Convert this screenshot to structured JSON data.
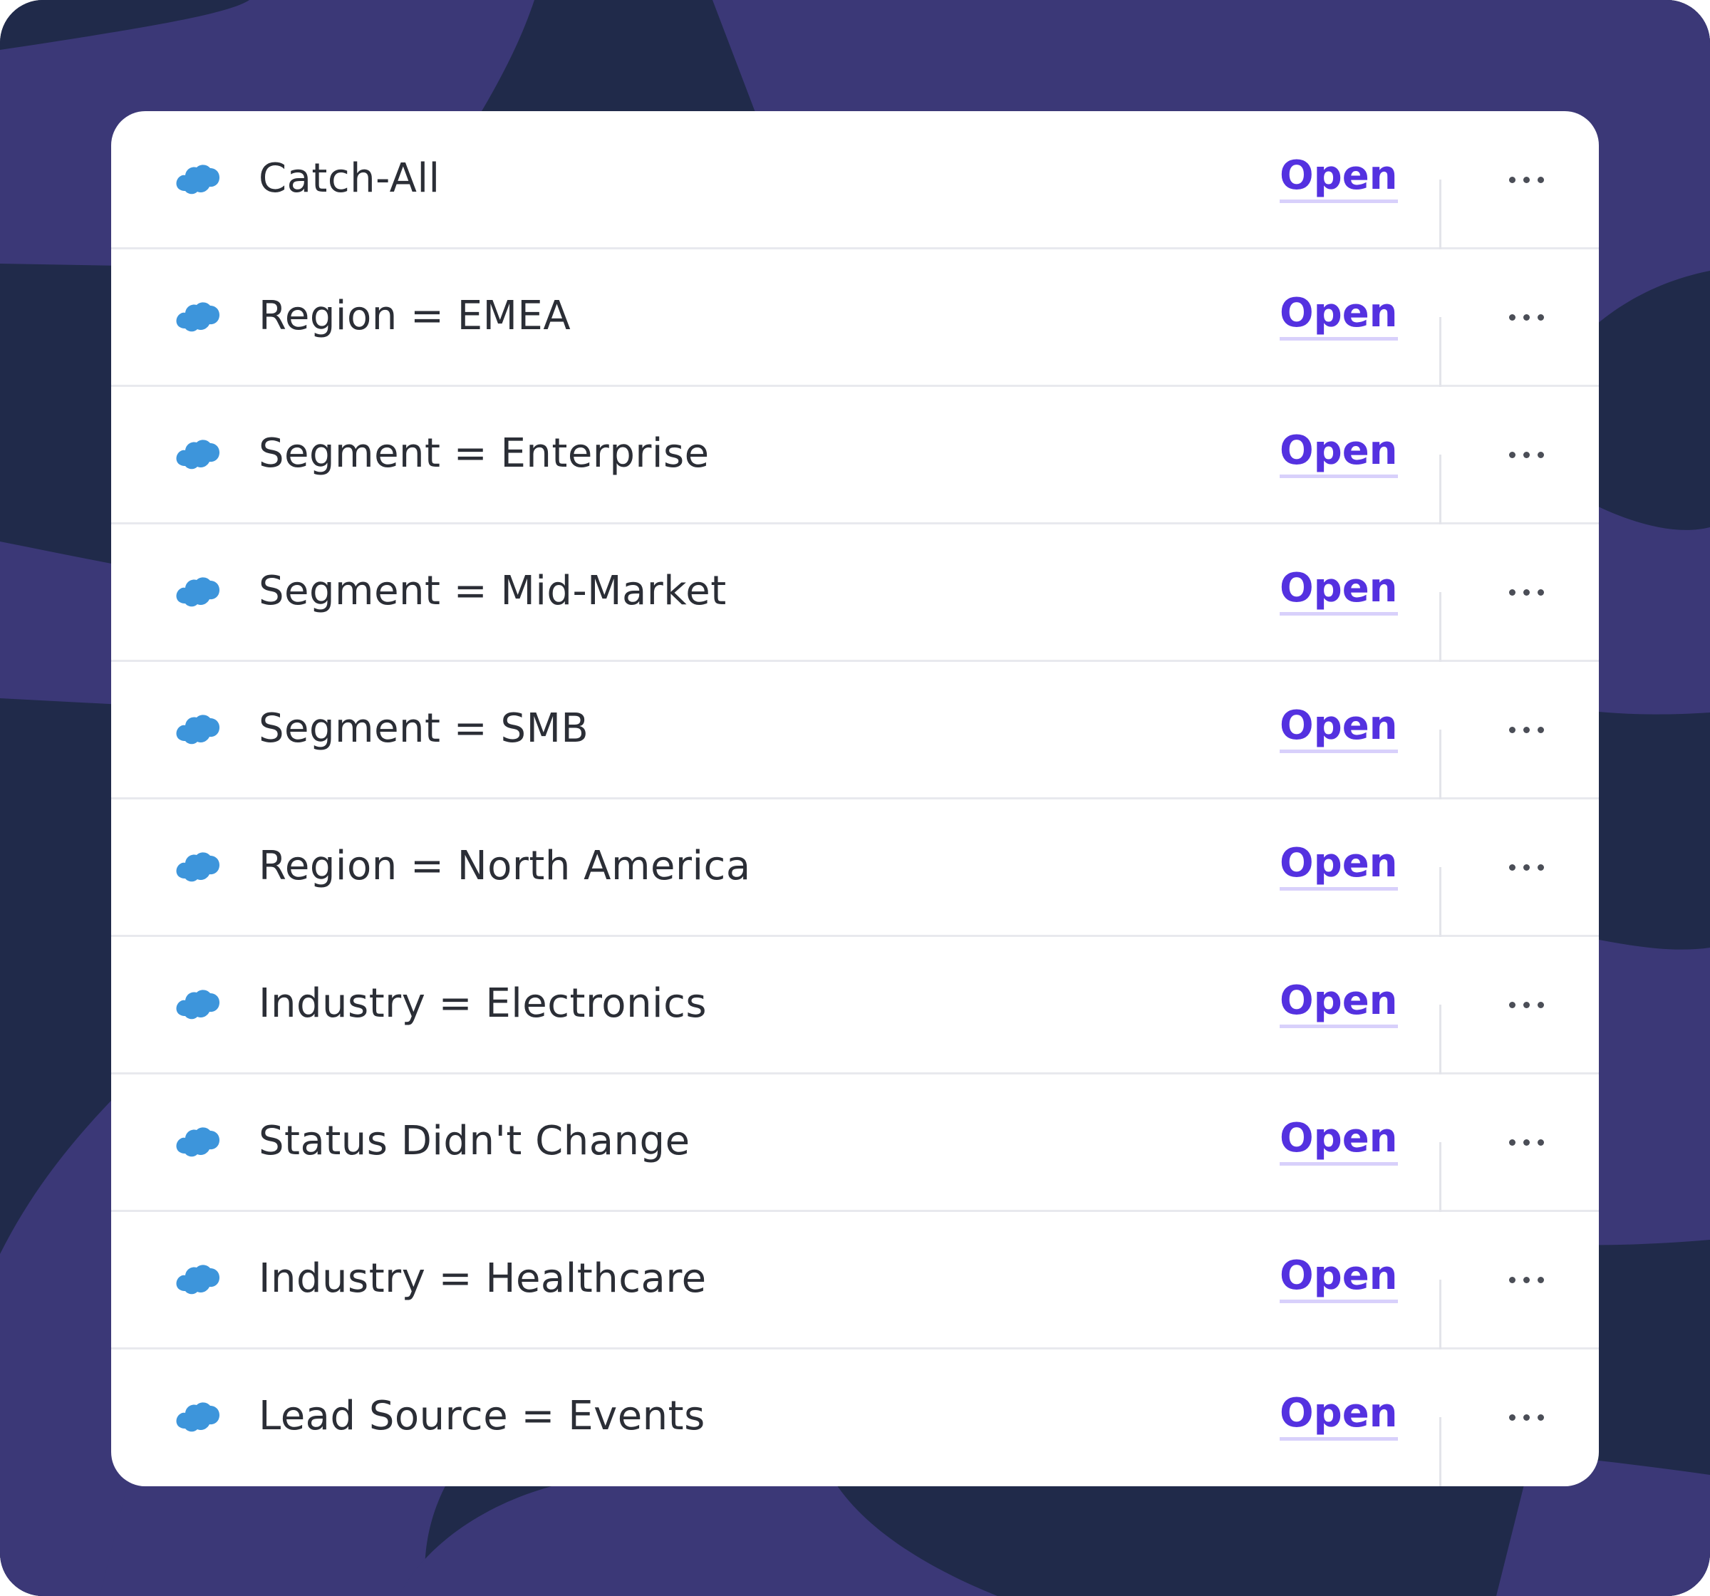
{
  "colors": {
    "background_dark": "#202a4a",
    "background_purple": "#3b3877",
    "card": "#ffffff",
    "link": "#5431e0",
    "link_underline": "#d8d0fb",
    "cloud_icon": "#3d95db",
    "text": "#2b2e36"
  },
  "rows": [
    {
      "icon": "salesforce-cloud-icon",
      "label": "Catch-All",
      "action": "Open",
      "menu": "more-icon"
    },
    {
      "icon": "salesforce-cloud-icon",
      "label": "Region = EMEA",
      "action": "Open",
      "menu": "more-icon"
    },
    {
      "icon": "salesforce-cloud-icon",
      "label": "Segment = Enterprise",
      "action": "Open",
      "menu": "more-icon"
    },
    {
      "icon": "salesforce-cloud-icon",
      "label": "Segment = Mid-Market",
      "action": "Open",
      "menu": "more-icon"
    },
    {
      "icon": "salesforce-cloud-icon",
      "label": "Segment = SMB",
      "action": "Open",
      "menu": "more-icon"
    },
    {
      "icon": "salesforce-cloud-icon",
      "label": "Region = North America",
      "action": "Open",
      "menu": "more-icon"
    },
    {
      "icon": "salesforce-cloud-icon",
      "label": "Industry = Electronics",
      "action": "Open",
      "menu": "more-icon"
    },
    {
      "icon": "salesforce-cloud-icon",
      "label": "Status Didn't Change",
      "action": "Open",
      "menu": "more-icon"
    },
    {
      "icon": "salesforce-cloud-icon",
      "label": "Industry = Healthcare",
      "action": "Open",
      "menu": "more-icon"
    },
    {
      "icon": "salesforce-cloud-icon",
      "label": "Lead Source = Events",
      "action": "Open",
      "menu": "more-icon"
    }
  ]
}
